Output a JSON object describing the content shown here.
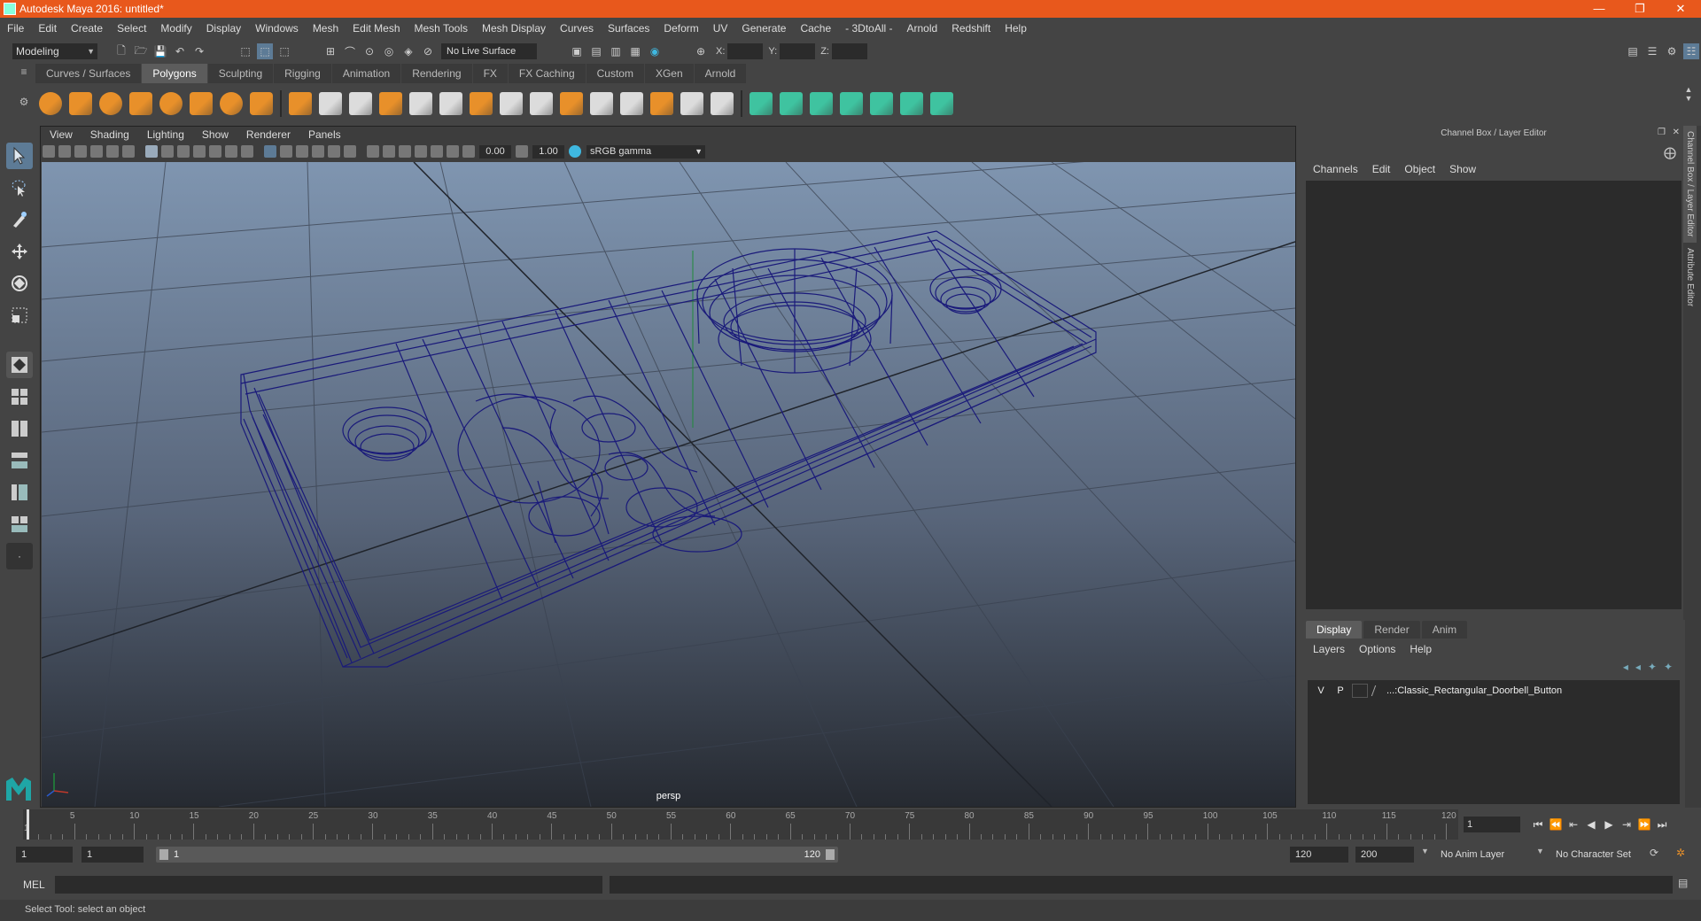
{
  "window": {
    "title": "Autodesk Maya 2016: untitled*",
    "controls": [
      "—",
      "❐",
      "✕"
    ]
  },
  "menubar": [
    "File",
    "Edit",
    "Create",
    "Select",
    "Modify",
    "Display",
    "Windows",
    "Mesh",
    "Edit Mesh",
    "Mesh Tools",
    "Mesh Display",
    "Curves",
    "Surfaces",
    "Deform",
    "UV",
    "Generate",
    "Cache",
    "- 3DtoAll -",
    "Arnold",
    "Redshift",
    "Help"
  ],
  "statusline": {
    "mode": "Modeling",
    "live_surface": "No Live Surface",
    "x_label": "X:",
    "y_label": "Y:",
    "z_label": "Z:"
  },
  "shelf": {
    "tabs": [
      "Curves / Surfaces",
      "Polygons",
      "Sculpting",
      "Rigging",
      "Animation",
      "Rendering",
      "FX",
      "FX Caching",
      "Custom",
      "XGen",
      "Arnold"
    ],
    "active_tab": "Polygons",
    "orange_icon_count_hint": "poly primitives",
    "colors": {
      "orange": "#e8902a",
      "white": "#dcdcdc",
      "green": "#3fc3a0"
    }
  },
  "viewport": {
    "menu": [
      "View",
      "Shading",
      "Lighting",
      "Show",
      "Renderer",
      "Panels"
    ],
    "field_a": "0.00",
    "field_b": "1.00",
    "color_space": "sRGB gamma",
    "camera": "persp",
    "wire_color": "#1a1a7a",
    "bg_top": "#7f95b0",
    "bg_bottom": "#2a2f36"
  },
  "channelbox": {
    "title": "Channel Box / Layer Editor",
    "menu": [
      "Channels",
      "Edit",
      "Object",
      "Show"
    ]
  },
  "side_tabs": [
    "Channel Box / Layer Editor",
    "Attribute Editor"
  ],
  "layer_editor": {
    "tabs": [
      "Display",
      "Render",
      "Anim"
    ],
    "active_tab": "Display",
    "menu": [
      "Layers",
      "Options",
      "Help"
    ],
    "layers": [
      {
        "v": "V",
        "p": "P",
        "name": "...:Classic_Rectangular_Doorbell_Button"
      }
    ]
  },
  "timeline": {
    "ticks": [
      "5",
      "10",
      "15",
      "20",
      "25",
      "30",
      "35",
      "40",
      "45",
      "50",
      "55",
      "60",
      "65",
      "70",
      "75",
      "80",
      "85",
      "90",
      "95",
      "100",
      "105",
      "110",
      "115",
      "120"
    ],
    "start_marker": "1",
    "current_frame": "1",
    "playback": [
      "⏮",
      "⏪",
      "⇤",
      "◀",
      "▶",
      "⇥",
      "⏩",
      "⏭"
    ]
  },
  "range": {
    "start": "1",
    "playback_start": "1",
    "slider_start": "1",
    "slider_end": "120",
    "playback_end": "120",
    "end": "200",
    "anim_layer": "No Anim Layer",
    "character_set": "No Character Set"
  },
  "cmdline": {
    "label": "MEL"
  },
  "helpline": {
    "text": "Select Tool: select an object"
  }
}
